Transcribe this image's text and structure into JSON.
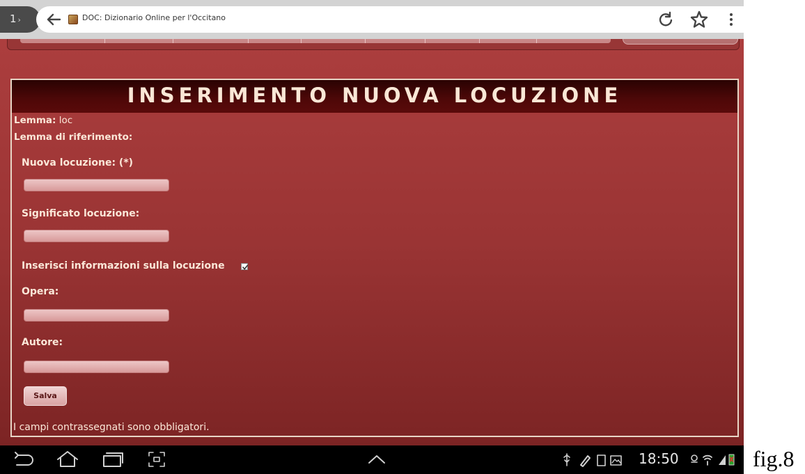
{
  "browser": {
    "tab_count": "1",
    "url_text": "DOC: Dizionario Online per l'Occitano"
  },
  "form": {
    "title": "INSERIMENTO NUOVA LOCUZIONE",
    "lemma_label": "Lemma:",
    "lemma_value": "loc",
    "lemma_ref_label": "Lemma di riferimento:",
    "new_locution_label": "Nuova locuzione: (*)",
    "new_locution_value": "",
    "meaning_label": "Significato locuzione:",
    "meaning_value": "",
    "info_checkbox_label": "Inserisci informazioni sulla locuzione",
    "info_checkbox_checked": true,
    "work_label": "Opera:",
    "work_value": "",
    "author_label": "Autore:",
    "author_value": "",
    "save_label": "Salva",
    "required_note": "I campi contrassegnati sono obbligatori."
  },
  "status_bar": {
    "time": "18:50"
  },
  "caption": "fig.8",
  "colors": {
    "page_bg": "#9a3434",
    "title_bar": "#4e0808",
    "text": "#fbe7d8"
  }
}
